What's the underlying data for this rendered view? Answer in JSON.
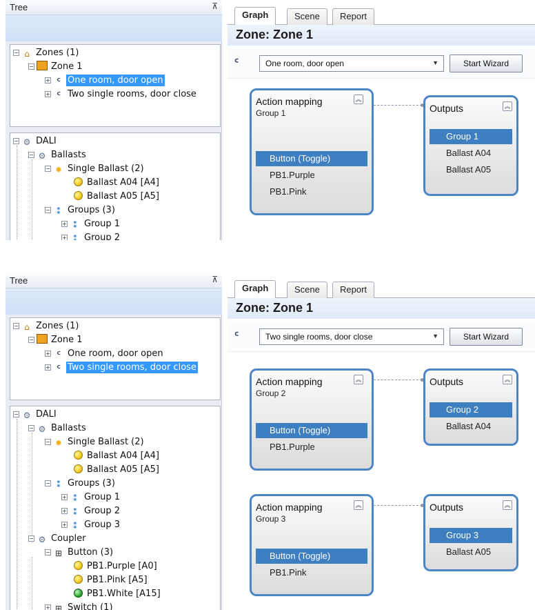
{
  "screens": [
    {
      "tree": {
        "header": "Tree",
        "pin": "⊼",
        "zones_label": "Zones (1)",
        "zone1_label": "Zone 1",
        "scene1": "One room, door open",
        "scene2": "Two single rooms, door close",
        "dali": "DALI",
        "ballasts": "Ballasts",
        "single_ballast": "Single Ballast (2)",
        "ballast_a04": "Ballast A04 [A4]",
        "ballast_a05": "Ballast A05 [A5]",
        "groups": "Groups (3)",
        "group1": "Group 1",
        "group2_partial": "Group 2"
      },
      "tabs": [
        "Graph",
        "Scene",
        "Report"
      ],
      "zone_title": "Zone: Zone 1",
      "selected_scene": "One room, door open",
      "start_wizard": "Start Wizard",
      "cards": [
        {
          "action_title": "Action mapping",
          "action_group": "Group 1",
          "action_items": [
            "Button (Toggle)",
            "PB1.Purple",
            "PB1.Pink"
          ],
          "outputs_title": "Outputs",
          "outputs_items": [
            "Group 1",
            "Ballast A04",
            "Ballast A05"
          ]
        }
      ]
    },
    {
      "tree": {
        "header": "Tree",
        "pin": "⊼",
        "zones_label": "Zones (1)",
        "zone1_label": "Zone 1",
        "scene1": "One room, door open",
        "scene2": "Two single rooms, door close",
        "dali": "DALI",
        "ballasts": "Ballasts",
        "single_ballast": "Single Ballast (2)",
        "ballast_a04": "Ballast A04 [A4]",
        "ballast_a05": "Ballast A05 [A5]",
        "groups": "Groups (3)",
        "group1": "Group 1",
        "group2": "Group 2",
        "group3": "Group 3",
        "coupler": "Coupler",
        "button": "Button (3)",
        "pb_purple": "PB1.Purple [A0]",
        "pb_pink": "PB1.Pink [A5]",
        "pb_white": "PB1.White [A15]",
        "switch_partial": "Switch (1)"
      },
      "tabs": [
        "Graph",
        "Scene",
        "Report"
      ],
      "zone_title": "Zone: Zone 1",
      "selected_scene": "Two single rooms, door close",
      "start_wizard": "Start Wizard",
      "cards": [
        {
          "action_title": "Action mapping",
          "action_group": "Group 2",
          "action_items": [
            "Button (Toggle)",
            "PB1.Purple"
          ],
          "outputs_title": "Outputs",
          "outputs_items": [
            "Group 2",
            "Ballast A04"
          ]
        },
        {
          "action_title": "Action mapping",
          "action_group": "Group 3",
          "action_items": [
            "Button (Toggle)",
            "PB1.Pink"
          ],
          "outputs_title": "Outputs",
          "outputs_items": [
            "Group 3",
            "Ballast A05"
          ]
        }
      ]
    }
  ],
  "icons": {
    "expand": "⊟",
    "collapse_card": "︽",
    "scene_icon": "ᑦ",
    "dropdown": "▼",
    "home": "⌂",
    "gear": "⚙",
    "sun": "✹",
    "groups": "⁑",
    "coupler": "⊞"
  },
  "colors": {
    "accent": "#4a86c6",
    "selection": "#3399ff",
    "list_selection": "#3d7fc0"
  }
}
